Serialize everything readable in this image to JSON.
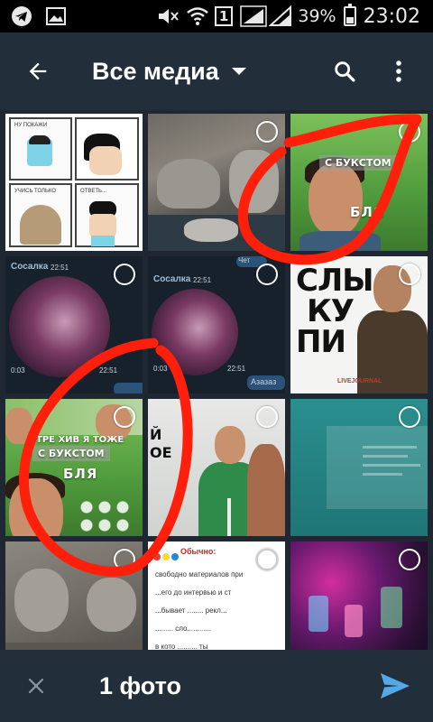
{
  "status_bar": {
    "battery_percent": "39%",
    "time": "23:02",
    "sim_label": "1",
    "icons": [
      "telegram-icon",
      "gallery-icon",
      "mute-icon",
      "wifi-icon",
      "signal-icon",
      "signal-icon",
      "battery-icon"
    ]
  },
  "toolbar": {
    "title": "Все медиа",
    "back_icon": "arrow-left-icon",
    "search_icon": "search-icon",
    "more_icon": "more-vert-icon"
  },
  "grid": {
    "tiles": [
      {
        "kind": "comic",
        "texts": [
          "НУ ПОКАЖИ",
          "УЧИСЬ ТОЛЬКО",
          "ОТВЕТЬ..."
        ]
      },
      {
        "kind": "cats"
      },
      {
        "kind": "meme-man",
        "captions": [
          "С БУКСТОМ",
          "БЛЯ"
        ]
      },
      {
        "kind": "video-message",
        "header": "Сосалка",
        "header_time": "22:51",
        "duration": "0:03",
        "time": "22:51"
      },
      {
        "kind": "video-message",
        "header": "Сосалка",
        "header_time": "22:51",
        "chip": "Чет",
        "duration": "0:03",
        "time": "22:51",
        "footer": "Азазаз"
      },
      {
        "kind": "poster",
        "lines": [
          "СЛЫ",
          "КУ",
          "ПИ"
        ],
        "logo": "LIVEJOURNAL"
      },
      {
        "kind": "meme-man",
        "captions": [
          "С БУКСТОМ",
          "БЛЯ"
        ],
        "top_text": "ТРЕ ХИВ Я ТОЖЕ"
      },
      {
        "kind": "street",
        "side_text": "Й\nОЕ"
      },
      {
        "kind": "teal-doc"
      },
      {
        "kind": "cats-2"
      },
      {
        "kind": "document",
        "lines": [
          "Обычно:",
          "свободно материалов при",
          "...его до интервью и ст",
          "...бывает ........ рекл...",
          "......... сло............",
          "в кото .......... ты"
        ]
      },
      {
        "kind": "club"
      }
    ]
  },
  "bottom_bar": {
    "close_icon": "close-icon",
    "selected_count": "1 фото",
    "send_icon": "send-icon"
  },
  "colors": {
    "background": "#1e2732",
    "toolbar": "#222e39",
    "status_bar": "#000000",
    "accent_send": "#55a8e8",
    "annotation": "#ff1f0a"
  }
}
